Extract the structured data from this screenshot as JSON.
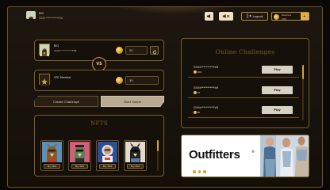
{
  "header": {
    "user_name": "BIG",
    "user_id": "0XXC**********FE8",
    "logout_label": "Logout",
    "balance_label": "Balance",
    "balance_value": "190",
    "plus_label": "+",
    "volume_up_icon": "speaker-icon",
    "volume_off_icon": "speaker-muted-icon"
  },
  "match": {
    "player1": {
      "name": "BIG",
      "id": "0XXC**********FE8",
      "bet": "20"
    },
    "vs_label": "VS",
    "player2": {
      "name": "CPC Member",
      "bet": "30"
    },
    "create_label": "Create Challenge",
    "start_label": "Start Game"
  },
  "nfts": {
    "title": "NFTS",
    "cards": [
      {
        "buy_label": "Buy Now",
        "colors": {
          "bg": "#5b90b8",
          "fg": "#8a5a2f"
        }
      },
      {
        "buy_label": "Buy Now",
        "colors": {
          "bg": "#d75c7a",
          "fg": "#5e7f53"
        }
      },
      {
        "buy_label": "Buy Now",
        "colors": {
          "bg": "#2f4e9a",
          "fg": "#e6e2dc"
        }
      },
      {
        "buy_label": "Buy Now",
        "colors": {
          "bg": "#e3d9cc",
          "fg": "#222222"
        }
      }
    ]
  },
  "challenges": {
    "title": "Online Challenges",
    "rows": [
      {
        "addr": "0X4fa**********FeB",
        "amount": "100",
        "play": "Play"
      },
      {
        "addr": "0X4fa**********FeB",
        "amount": "30",
        "play": "Play"
      },
      {
        "addr": "0X4fa**********FeB",
        "amount": "60",
        "play": "Play"
      }
    ]
  },
  "ad": {
    "brand": "Outfitters",
    "mark": "®"
  },
  "colors": {
    "gold": "#d9a63c",
    "panel_border": "#7a5d28",
    "background": "#150f0a"
  }
}
